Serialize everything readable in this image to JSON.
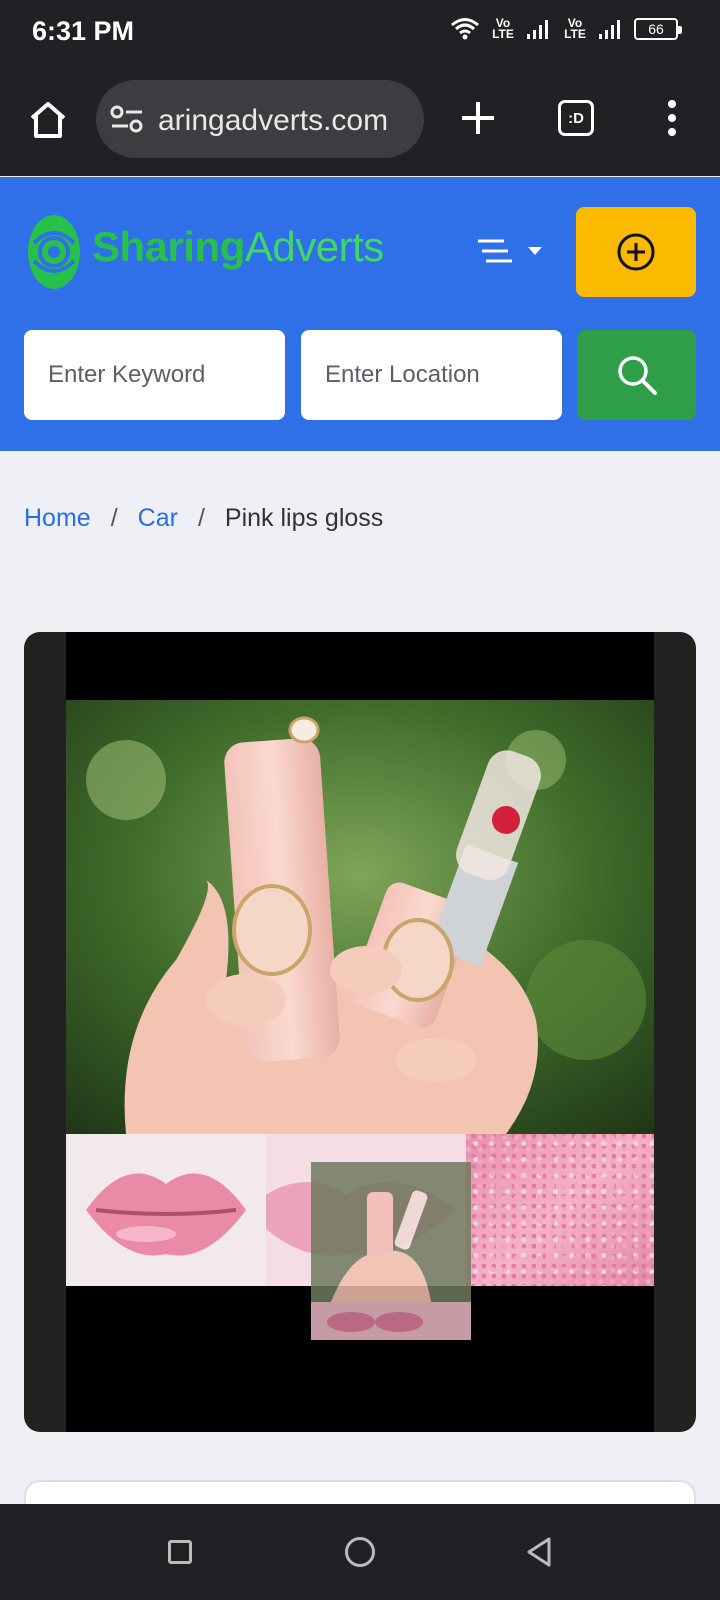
{
  "status_bar": {
    "time": "6:31 PM",
    "network_1": "Vo LTE",
    "network_2": "Vo LTE",
    "battery": "66"
  },
  "browser": {
    "url": "aringadverts.com",
    "tabs_label": ":D"
  },
  "header": {
    "logo_part1": "Sharing",
    "logo_part2": "Adverts",
    "keyword_placeholder": "Enter Keyword",
    "location_placeholder": "Enter Location",
    "accent_color": "#2f6fe8",
    "add_button_color": "#fbb900",
    "search_button_color": "#2e9e48"
  },
  "breadcrumb": {
    "home": "Home",
    "category": "Car",
    "current": "Pink lips gloss",
    "separator": "/"
  },
  "product": {
    "image_alt": "Pink lipstick product photo"
  }
}
